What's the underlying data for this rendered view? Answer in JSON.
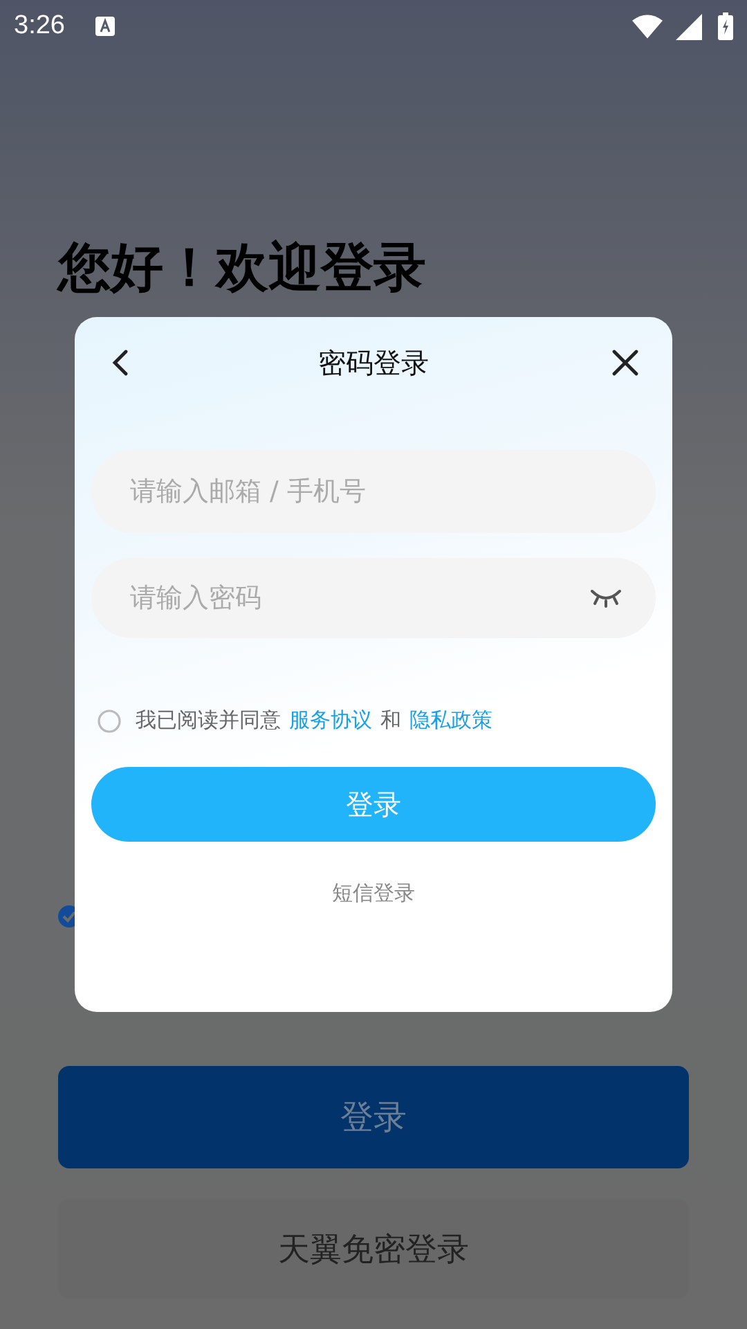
{
  "status_bar": {
    "time": "3:26"
  },
  "page": {
    "title": "您好！欢迎登录",
    "agree_checked": true,
    "login_button": "登录",
    "sso_button": "天翼免密登录"
  },
  "dialog": {
    "title": "密码登录",
    "account_field": {
      "placeholder": "请输入邮箱 / 手机号"
    },
    "password_field": {
      "placeholder": "请输入密码"
    },
    "agreement": {
      "checked": false,
      "text": "我已阅读并同意",
      "link_1": "服务协议",
      "joiner": "和",
      "link_2": "隐私政策"
    },
    "login_button": "登录",
    "sms_link": "短信登录"
  }
}
